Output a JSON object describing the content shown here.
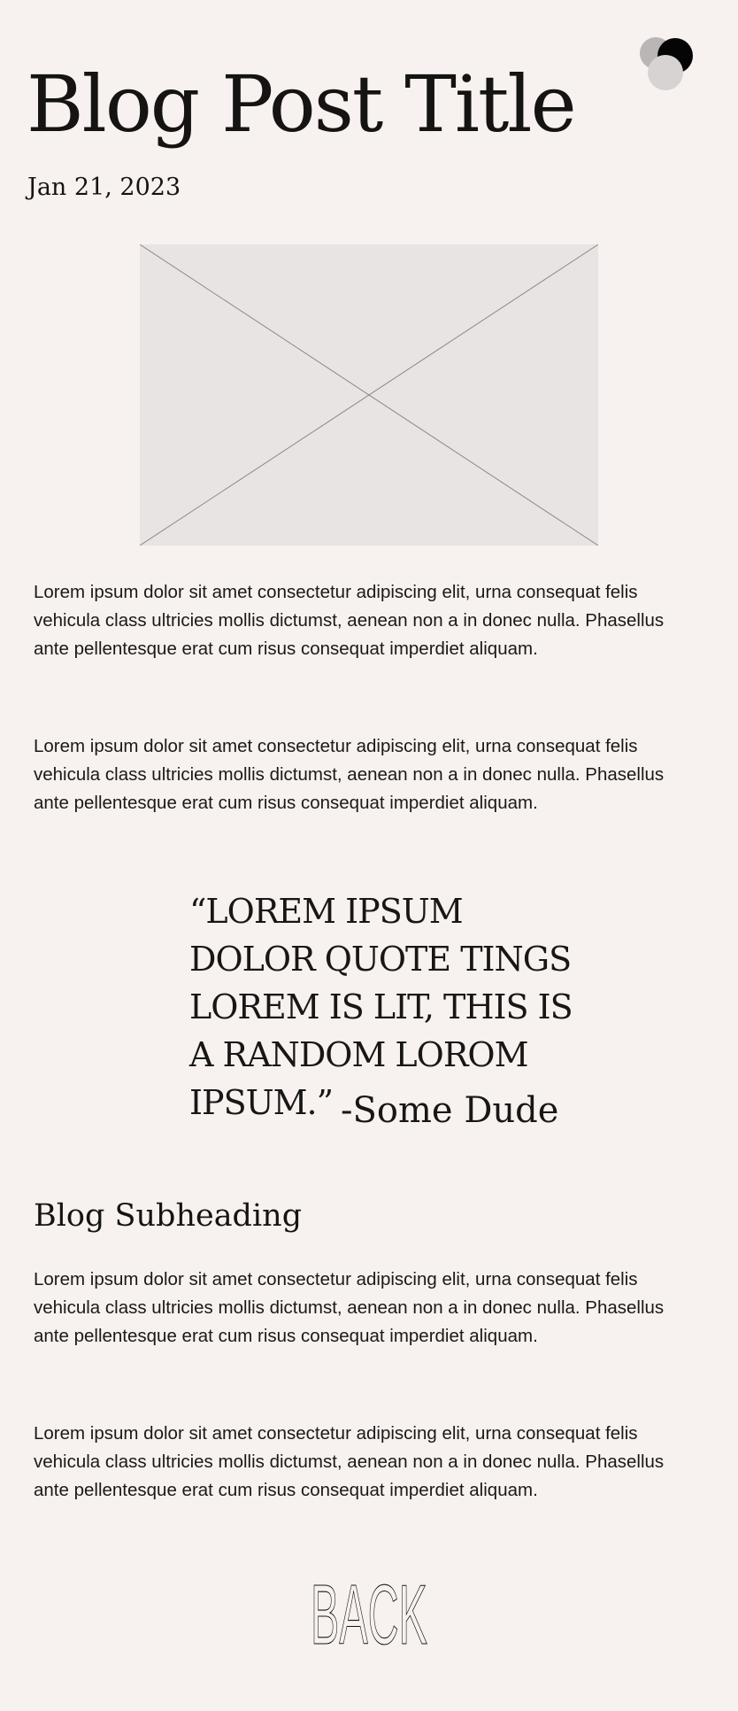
{
  "post": {
    "title": "Blog Post Title",
    "date": "Jan 21, 2023",
    "paragraphs": [
      "Lorem ipsum dolor sit amet consectetur adipiscing elit, urna consequat felis vehicula class ultricies mollis dictumst, aenean non a in donec nulla. Phasellus ante pellentesque erat cum risus consequat imperdiet aliquam.",
      "Lorem ipsum dolor sit amet consectetur adipiscing elit, urna consequat felis vehicula class ultricies mollis dictumst, aenean non a in donec nulla. Phasellus ante pellentesque erat cum risus consequat imperdiet aliquam.",
      "Lorem ipsum dolor sit amet consectetur adipiscing elit, urna consequat felis vehicula class ultricies mollis dictumst, aenean non a in donec nulla. Phasellus ante pellentesque erat cum risus consequat imperdiet aliquam.",
      "Lorem ipsum dolor sit amet consectetur adipiscing elit, urna consequat felis vehicula class ultricies mollis dictumst, aenean non a in donec nulla. Phasellus ante pellentesque erat cum risus consequat imperdiet aliquam."
    ],
    "quote": {
      "text": "“LOREM IPSUM DOLOR QUOTE TINGS LOREM IS LIT, THIS IS A RANDOM LOROM IPSUM.”",
      "attribution": "-Some Dude"
    },
    "subheading": "Blog Subheading"
  },
  "nav": {
    "back_label": "BACK"
  },
  "icons": {
    "logo": "overlapping-circles-logo",
    "hero_image": "image-placeholder"
  },
  "colors": {
    "background": "#f7f2f0",
    "text": "#161412",
    "placeholder": "#e8e4e3",
    "logo_dark": "#050505",
    "logo_mid": "#b9b6b5",
    "logo_light": "#d6d3d2"
  }
}
